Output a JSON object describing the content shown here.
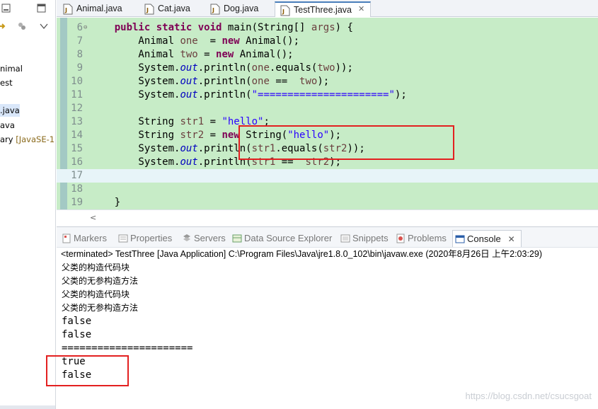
{
  "explorer": {
    "items": [
      {
        "label": "nimal",
        "selected": false
      },
      {
        "label": "est",
        "selected": false
      },
      {
        "label": ".java",
        "selected": true
      },
      {
        "label": "ava",
        "selected": false
      },
      {
        "label": "ary",
        "suffix": " [JavaSE-1.",
        "selected": false
      }
    ]
  },
  "editor": {
    "tabs": [
      {
        "label": "Animal.java",
        "active": false
      },
      {
        "label": "Cat.java",
        "active": false
      },
      {
        "label": "Dog.java",
        "active": false
      },
      {
        "label": "TestThree.java",
        "active": true
      }
    ],
    "close_glyph": "✕",
    "lines": [
      {
        "n": "6",
        "fold": "⊖",
        "tokens": [
          [
            "t",
            "    "
          ],
          [
            "kw",
            "public"
          ],
          [
            "t",
            " "
          ],
          [
            "kw",
            "static"
          ],
          [
            "t",
            " "
          ],
          [
            "kw",
            "void"
          ],
          [
            "t",
            " main(String[] "
          ],
          [
            "var",
            "args"
          ],
          [
            "t",
            ") {"
          ]
        ]
      },
      {
        "n": "7",
        "tokens": [
          [
            "t",
            "        Animal "
          ],
          [
            "var",
            "one"
          ],
          [
            "t",
            "  = "
          ],
          [
            "kw",
            "new"
          ],
          [
            "t",
            " Animal();"
          ]
        ]
      },
      {
        "n": "8",
        "tokens": [
          [
            "t",
            "        Animal "
          ],
          [
            "var",
            "two"
          ],
          [
            "t",
            " = "
          ],
          [
            "kw",
            "new"
          ],
          [
            "t",
            " Animal();"
          ]
        ]
      },
      {
        "n": "9",
        "tokens": [
          [
            "t",
            "        System."
          ],
          [
            "fld",
            "out"
          ],
          [
            "t",
            ".println("
          ],
          [
            "var",
            "one"
          ],
          [
            "t",
            ".equals("
          ],
          [
            "var",
            "two"
          ],
          [
            "t",
            "));"
          ]
        ]
      },
      {
        "n": "10",
        "tokens": [
          [
            "t",
            "        System."
          ],
          [
            "fld",
            "out"
          ],
          [
            "t",
            ".println("
          ],
          [
            "var",
            "one"
          ],
          [
            "t",
            " ==  "
          ],
          [
            "var",
            "two"
          ],
          [
            "t",
            ");"
          ]
        ]
      },
      {
        "n": "11",
        "tokens": [
          [
            "t",
            "        System."
          ],
          [
            "fld",
            "out"
          ],
          [
            "t",
            ".println("
          ],
          [
            "str",
            "\"======================\""
          ],
          [
            "t",
            ");"
          ]
        ]
      },
      {
        "n": "12",
        "tokens": []
      },
      {
        "n": "13",
        "tokens": [
          [
            "t",
            "        String "
          ],
          [
            "var",
            "str1"
          ],
          [
            "t",
            " = "
          ],
          [
            "str",
            "\"hello\""
          ],
          [
            "t",
            ";"
          ]
        ]
      },
      {
        "n": "14",
        "tokens": [
          [
            "t",
            "        String "
          ],
          [
            "var",
            "str2"
          ],
          [
            "t",
            " = "
          ],
          [
            "kw",
            "new"
          ],
          [
            "t",
            " String("
          ],
          [
            "str",
            "\"hello\""
          ],
          [
            "t",
            ");"
          ]
        ]
      },
      {
        "n": "15",
        "tokens": [
          [
            "t",
            "        System."
          ],
          [
            "fld",
            "out"
          ],
          [
            "t",
            ".println("
          ],
          [
            "var",
            "str1"
          ],
          [
            "t",
            ".equals("
          ],
          [
            "var",
            "str2"
          ],
          [
            "t",
            "));"
          ]
        ]
      },
      {
        "n": "16",
        "tokens": [
          [
            "t",
            "        System."
          ],
          [
            "fld",
            "out"
          ],
          [
            "t",
            ".println("
          ],
          [
            "var",
            "str1"
          ],
          [
            "t",
            " ==  "
          ],
          [
            "var",
            "str2"
          ],
          [
            "t",
            ");"
          ]
        ]
      },
      {
        "n": "17",
        "tokens": [],
        "current": true
      },
      {
        "n": "18",
        "tokens": []
      },
      {
        "n": "19",
        "tokens": [
          [
            "t",
            "    }"
          ]
        ]
      }
    ],
    "hscroll_arrow": "<"
  },
  "views": {
    "tabs": [
      {
        "label": "Markers",
        "icon": "markers-icon",
        "active": false
      },
      {
        "label": "Properties",
        "icon": "properties-icon",
        "active": false
      },
      {
        "label": "Servers",
        "icon": "servers-icon",
        "active": false
      },
      {
        "label": "Data Source Explorer",
        "icon": "data-source-icon",
        "active": false
      },
      {
        "label": "Snippets",
        "icon": "snippets-icon",
        "active": false
      },
      {
        "label": "Problems",
        "icon": "problems-icon",
        "active": false
      },
      {
        "label": "Console",
        "icon": "console-icon",
        "active": true
      }
    ],
    "close_glyph": "✕"
  },
  "console": {
    "header": "<terminated> TestThree [Java Application] C:\\Program Files\\Java\\jre1.8.0_102\\bin\\javaw.exe (2020年8月26日 上午2:03:29)",
    "output": [
      {
        "text": "父类的构造代码块",
        "cjk": true
      },
      {
        "text": "父类的无参构造方法",
        "cjk": true
      },
      {
        "text": "父类的构造代码块",
        "cjk": true
      },
      {
        "text": "父类的无参构造方法",
        "cjk": true
      },
      {
        "text": "false",
        "cjk": false
      },
      {
        "text": "false",
        "cjk": false
      },
      {
        "text": "======================",
        "cjk": false
      },
      {
        "text": "true",
        "cjk": false
      },
      {
        "text": "false",
        "cjk": false
      }
    ],
    "watermark": "https://blog.csdn.net/csucsgoat"
  },
  "colors": {
    "editor_bg": "#c7ecc7",
    "highlight_box": "#e32020",
    "keyword": "#7f0055",
    "string": "#2a00ff",
    "field": "#0000c0"
  }
}
